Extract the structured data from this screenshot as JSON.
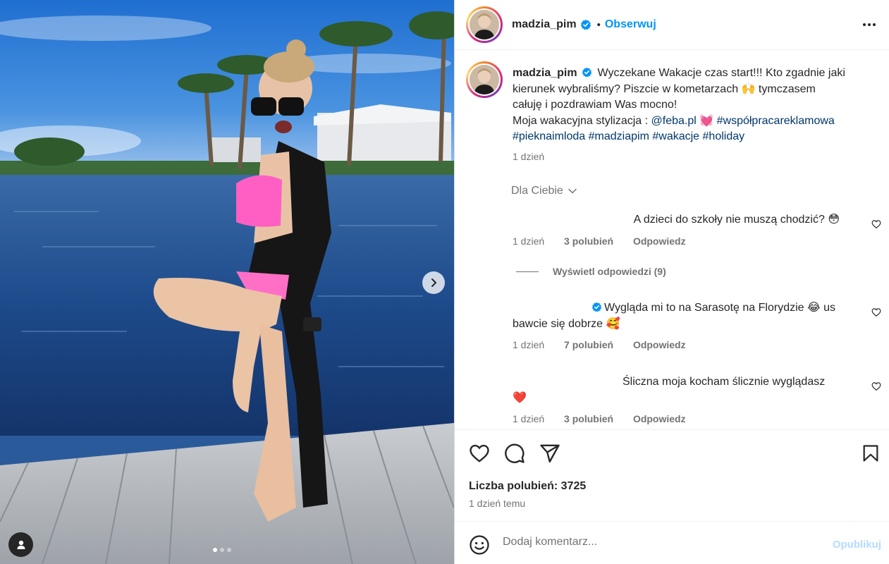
{
  "post": {
    "username": "madzia_pim",
    "follow_label": "Obserwuj",
    "bullet": "•",
    "caption": {
      "username": "madzia_pim",
      "line1": "Wyczekane Wakacje czas start!!! Kto zgadnie jaki",
      "line2_a": "kierunek wybraliśmy? Piszcie w kometarzach ",
      "emoji_hands": "🙌",
      "line2_b": "  tymczasem",
      "line3": "całuję i pozdrawiam Was mocno!",
      "line4_a": "Moja wakacyjna stylizacja : ",
      "mention": "@feba.pl",
      "emoji_heart": "💓",
      "hashtag1": "#współpracareklamowa",
      "hashtag2": "#pieknaimloda",
      "hashtag3": "#madziapim",
      "hashtag4": "#wakacje",
      "hashtag5": "#holiday",
      "time": "1 dzień"
    },
    "for_you_label": "Dla Ciebie",
    "comments": [
      {
        "text": "A dzieci do szkoły nie muszą chodzić?",
        "emoji": "😳",
        "time": "1 dzień",
        "likes": "3 polubień",
        "reply": "Odpowiedz"
      },
      {
        "text_a": "Wygląda mi to na Sarasotę na Florydzie ",
        "emoji1": "😂",
        "text_b": " us",
        "text_c": "bawcie się dobrze ",
        "emoji2": "🥰",
        "time": "1 dzień",
        "likes": "7 polubień",
        "reply": "Odpowiedz"
      },
      {
        "text": "Śliczna moja kocham ślicznie wyglądasz",
        "emoji": "❤️",
        "time": "1 dzień",
        "likes": "3 polubień",
        "reply": "Odpowiedz"
      }
    ],
    "view_replies_label": "Wyświetl odpowiedzi (9)",
    "likes_label": "Liczba polubień: 3725",
    "date_label": "1 dzień temu",
    "add_comment_placeholder": "Dodaj komentarz...",
    "publish_label": "Opublikuj",
    "carousel": {
      "total": 3,
      "current": 1
    }
  },
  "colors": {
    "accent": "#0095f6",
    "link": "#00376b",
    "muted": "#737373",
    "publish_disabled": "#b3dbff"
  },
  "icons": [
    "chevron-right-icon",
    "user-tag-icon",
    "verified-icon",
    "more-icon",
    "chevron-down-icon",
    "heart-icon",
    "comment-icon",
    "share-icon",
    "bookmark-icon",
    "emoji-icon"
  ]
}
